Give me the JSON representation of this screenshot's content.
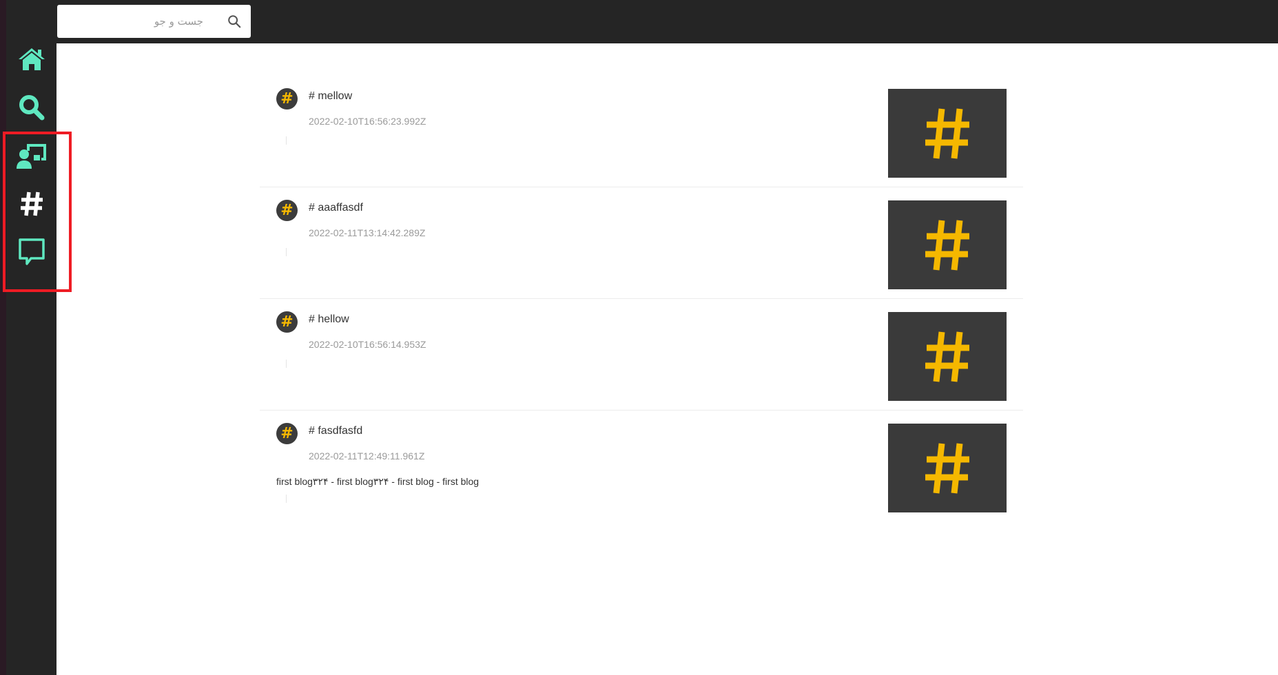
{
  "search": {
    "placeholder": "جست و جو"
  },
  "sidebar": {
    "items": [
      {
        "name": "home",
        "icon": "home-icon",
        "color": "#5fe8c0"
      },
      {
        "name": "search",
        "icon": "search-icon",
        "color": "#5fe8c0"
      },
      {
        "name": "dashboard",
        "icon": "user-presentation-icon",
        "color": "#5fe8c0"
      },
      {
        "name": "hashtags",
        "icon": "hashtag-icon",
        "color": "#ffffff"
      },
      {
        "name": "messages",
        "icon": "chat-bubble-icon",
        "color": "#5fe8c0"
      }
    ]
  },
  "colors": {
    "accent": "#5fe8c0",
    "hash": "#f5b800",
    "highlight": "#ee1c24",
    "dark": "#252525"
  },
  "posts": [
    {
      "title": "# mellow",
      "date": "2022-02-10T16:56:23.992Z",
      "body": ""
    },
    {
      "title": "# aaaffasdf",
      "date": "2022-02-11T13:14:42.289Z",
      "body": ""
    },
    {
      "title": "# hellow",
      "date": "2022-02-10T16:56:14.953Z",
      "body": ""
    },
    {
      "title": "# fasdfasfd",
      "date": "2022-02-11T12:49:11.961Z",
      "body": "first blog۳۲۴ - first blog۳۲۴ - first blog - first blog"
    }
  ]
}
